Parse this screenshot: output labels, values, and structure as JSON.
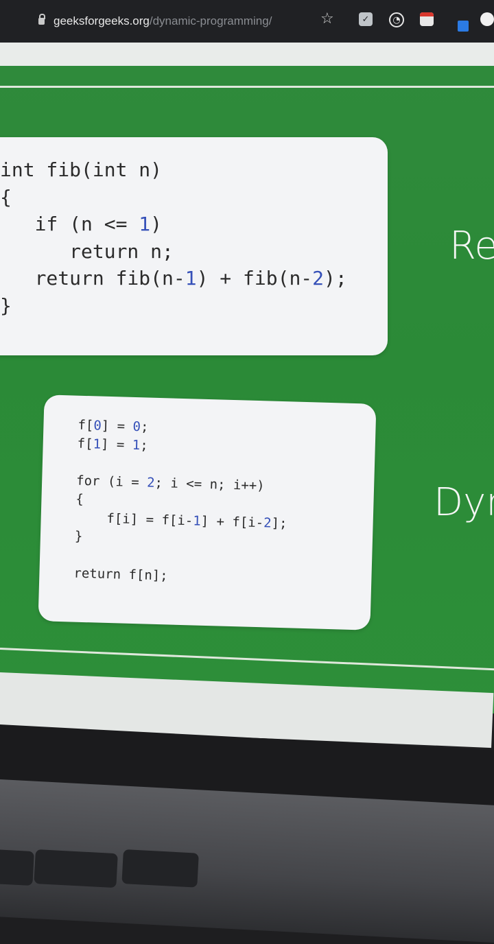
{
  "browser": {
    "url_domain": "geeksforgeeks.org",
    "url_path": "/dynamic-programming/",
    "icons": [
      "lock-icon",
      "star-icon",
      "check-extension-icon",
      "gauge-extension-icon",
      "calendar-extension-icon",
      "blue-extension-icon",
      "profile-icon"
    ]
  },
  "slide": {
    "recursive_code": "int fib(int n)\n{\n   if (n <= 1)\n      return n;\n   return fib(n-1) + fib(n-2);\n}",
    "dp_code": "f[0] = 0;\nf[1] = 1;\n\nfor (i = 2; i <= n; i++)\n{\n    f[i] = f[i-1] + f[i-2];\n}\n\nreturn f[n];",
    "side_label_top": "Re",
    "side_label_bottom": "Dyr"
  },
  "colors": {
    "slide_green": "#2d8a39",
    "code_box_bg": "#f3f4f6",
    "number_color": "#3550b8"
  }
}
